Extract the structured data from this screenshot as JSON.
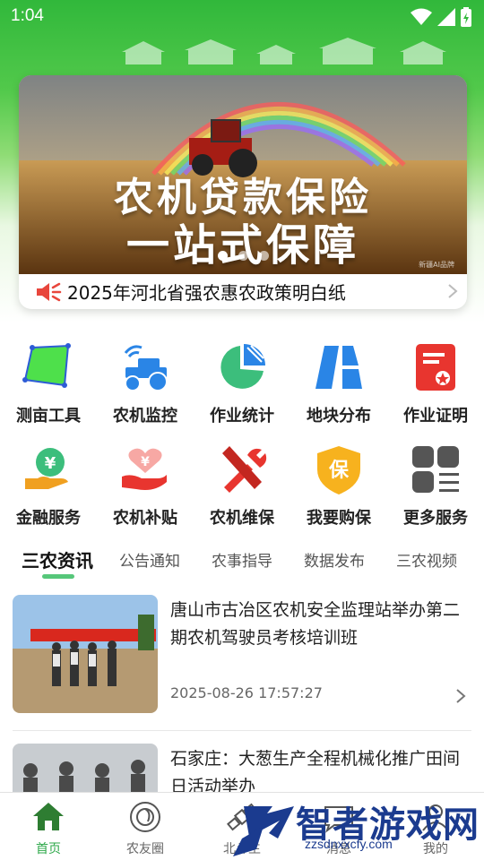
{
  "status": {
    "time": "1:04"
  },
  "banner": {
    "line1": "农机贷款保险",
    "line2": "一站式保障",
    "watermark": "新疆AI品牌",
    "slides": 3,
    "active_slide": 1
  },
  "notice": {
    "text": "2025年河北省强农惠农政策明白纸"
  },
  "services": [
    {
      "label": "测亩工具",
      "icon": "measure-icon"
    },
    {
      "label": "农机监控",
      "icon": "tractor-signal-icon"
    },
    {
      "label": "作业统计",
      "icon": "pie-chart-icon"
    },
    {
      "label": "地块分布",
      "icon": "field-map-icon"
    },
    {
      "label": "作业证明",
      "icon": "certificate-icon"
    },
    {
      "label": "金融服务",
      "icon": "finance-icon"
    },
    {
      "label": "农机补贴",
      "icon": "subsidy-icon"
    },
    {
      "label": "农机维保",
      "icon": "repair-icon"
    },
    {
      "label": "我要购保",
      "icon": "insurance-icon"
    },
    {
      "label": "更多服务",
      "icon": "more-icon"
    }
  ],
  "tabs": [
    {
      "label": "三农资讯",
      "active": true
    },
    {
      "label": "公告通知"
    },
    {
      "label": "农事指导"
    },
    {
      "label": "数据发布"
    },
    {
      "label": "三农视频"
    }
  ],
  "news": [
    {
      "title": "唐山市古冶区农机安全监理站举办第二期农机驾驶员考核培训班",
      "date": "2025-08-26 17:57:27"
    },
    {
      "title": "石家庄：大葱生产全程机械化推广田间日活动举办",
      "date": ""
    }
  ],
  "bottom_nav": [
    {
      "label": "首页",
      "icon": "home-icon",
      "active": true
    },
    {
      "label": "农友圈",
      "icon": "circle-icon"
    },
    {
      "label": "北斗生",
      "icon": "satellite-icon"
    },
    {
      "label": "消息",
      "icon": "message-icon"
    },
    {
      "label": "我的",
      "icon": "profile-icon"
    }
  ],
  "watermark": {
    "text": "智者游戏网",
    "url": "zzsdnxxcfy.com"
  },
  "colors": {
    "primary": "#2ea84a",
    "header_green": "#31b83b",
    "tab_indicator": "#56c77a",
    "notice_red": "#e8463c"
  }
}
